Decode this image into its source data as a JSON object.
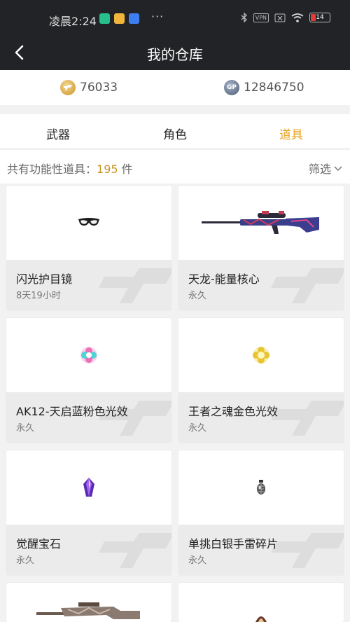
{
  "status_bar": {
    "time": "凌晨2:24",
    "dots": "···",
    "vpn": "VPN",
    "battery": "14"
  },
  "nav": {
    "title": "我的仓库"
  },
  "currency": {
    "gold": "76033",
    "gp_label": "GP",
    "gp": "12846750"
  },
  "tabs": [
    {
      "label": "武器"
    },
    {
      "label": "角色"
    },
    {
      "label": "道具",
      "active": true
    }
  ],
  "summary": {
    "prefix": "共有功能性道具：",
    "count": "195",
    "unit": " 件",
    "filter": "筛选"
  },
  "items": [
    {
      "name": "闪光护目镜",
      "duration": "8天19小时",
      "icon": "goggles-icon"
    },
    {
      "name": "天龙-能量核心",
      "duration": "永久",
      "icon": "sniper-rifle-icon"
    },
    {
      "name": "AK12-天启蓝粉色光效",
      "duration": "永久",
      "icon": "pink-blue-gem-icon"
    },
    {
      "name": "王者之魂金色光效",
      "duration": "永久",
      "icon": "gold-gem-icon"
    },
    {
      "name": "觉醒宝石",
      "duration": "永久",
      "icon": "purple-crystal-icon"
    },
    {
      "name": "单挑白银手雷碎片",
      "duration": "永久",
      "icon": "grenade-fragment-icon"
    },
    {
      "name": "",
      "duration": "",
      "icon": "assault-rifle-icon"
    },
    {
      "name": "",
      "duration": "",
      "icon": "ornament-icon"
    }
  ],
  "colors": {
    "header_bg": "#222326",
    "accent": "#e8a21e",
    "count_color": "#c9952b",
    "card_info_bg": "#ebebeb"
  }
}
